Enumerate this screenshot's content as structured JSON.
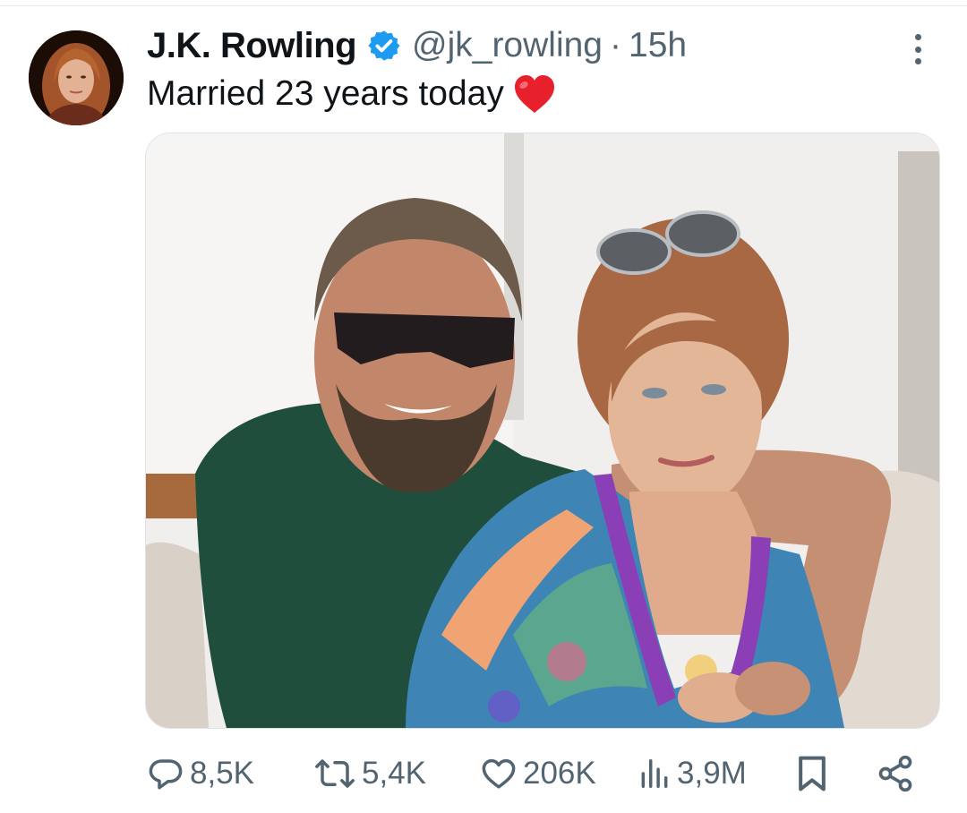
{
  "tweet": {
    "author_name": "J.K. Rowling",
    "handle": "@jk_rowling",
    "separator": "·",
    "timestamp": "15h",
    "text": "Married 23 years today",
    "verified": true
  },
  "actions": {
    "replies": "8,5K",
    "reposts": "5,4K",
    "likes": "206K",
    "views": "3,9M"
  },
  "icons": [
    "verified-badge-icon",
    "red-heart-emoji",
    "more-options-icon",
    "reply-icon",
    "repost-icon",
    "like-icon",
    "views-icon",
    "bookmark-icon",
    "share-icon"
  ],
  "colors": {
    "verified": "#1d9bf0",
    "text_primary": "#0f1419",
    "text_secondary": "#536471",
    "heart_emoji": "#e8202b"
  }
}
